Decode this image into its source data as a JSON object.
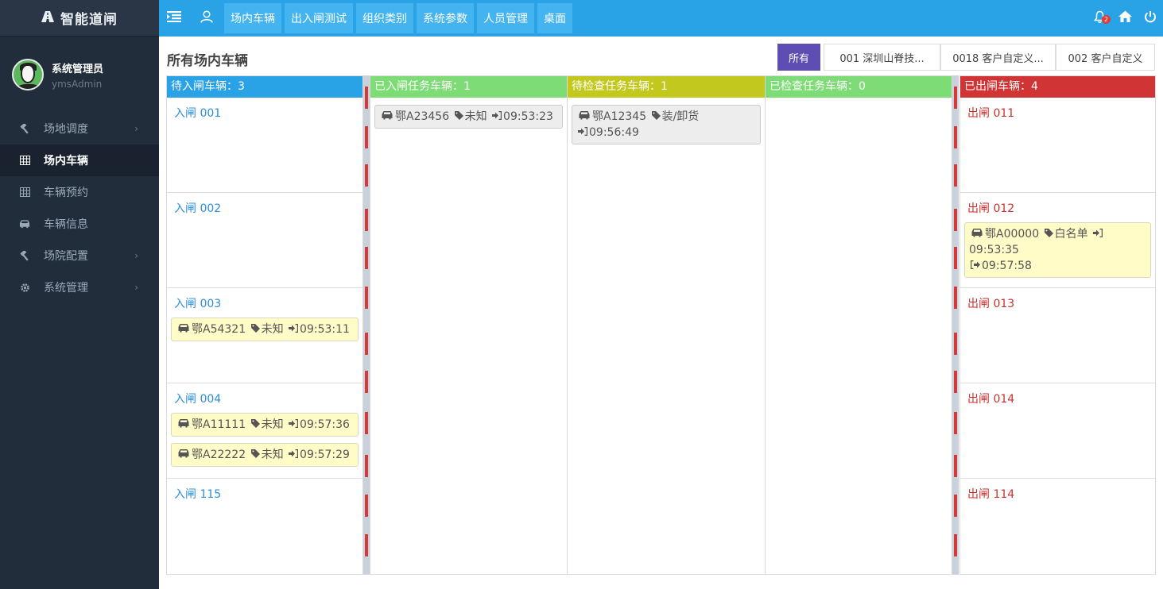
{
  "app": {
    "brand": "智能道闸"
  },
  "user": {
    "name": "系统管理员",
    "account": "ymsAdmin"
  },
  "sidebar": {
    "items": [
      {
        "label": "场地调度",
        "icon": "hammer-icon",
        "has_children": true
      },
      {
        "label": "场内车辆",
        "icon": "table-icon",
        "active": true
      },
      {
        "label": "车辆预约",
        "icon": "table-icon"
      },
      {
        "label": "车辆信息",
        "icon": "car-icon"
      },
      {
        "label": "场院配置",
        "icon": "hammer-icon",
        "has_children": true
      },
      {
        "label": "系统管理",
        "icon": "gear-icon",
        "has_children": true
      }
    ]
  },
  "topbar": {
    "tabs": [
      "场内车辆",
      "出入闸测试",
      "组织类别",
      "系统参数",
      "人员管理",
      "桌面"
    ],
    "notification_count": "2"
  },
  "page": {
    "title": "所有场内车辆"
  },
  "filters": [
    "所有",
    "001 深圳山脊技...",
    "0018 客户自定义...",
    "002 客户自定义"
  ],
  "columns": {
    "pending_in": {
      "header": "待入闸车辆：3",
      "color": "#29a2e6",
      "lanes": [
        {
          "title": "入闸 001",
          "cards": []
        },
        {
          "title": "入闸 002",
          "cards": []
        },
        {
          "title": "入闸 003",
          "cards": [
            {
              "plate": "鄂A54321",
              "tag": "未知",
              "in_time": "09:53:11"
            }
          ]
        },
        {
          "title": "入闸 004",
          "cards": [
            {
              "plate": "鄂A11111",
              "tag": "未知",
              "in_time": "09:57:36"
            },
            {
              "plate": "鄂A22222",
              "tag": "未知",
              "in_time": "09:57:29"
            }
          ]
        },
        {
          "title": "入闸 115",
          "cards": []
        }
      ]
    },
    "entered": {
      "header": "已入闸任务车辆：1",
      "color": "#7ddc75",
      "cards": [
        {
          "plate": "鄂A23456",
          "tag": "未知",
          "in_time": "09:53:23"
        }
      ]
    },
    "pending_check": {
      "header": "待检查任务车辆：1",
      "color": "#c3c81e",
      "cards": [
        {
          "plate": "鄂A12345",
          "tag": "装/卸货",
          "in_time": "09:56:49"
        }
      ]
    },
    "checked": {
      "header": "已检查任务车辆：0",
      "color": "#7ddc75",
      "cards": []
    },
    "exited": {
      "header": "已出闸车辆：4",
      "color": "#d13434",
      "lanes": [
        {
          "title": "出闸 011",
          "cards": []
        },
        {
          "title": "出闸 012",
          "cards": [
            {
              "plate": "鄂A00000",
              "tag": "白名单",
              "in_time": "09:53:35",
              "out_time": "09:57:58"
            }
          ]
        },
        {
          "title": "出闸 013",
          "cards": []
        },
        {
          "title": "出闸 014",
          "cards": []
        },
        {
          "title": "出闸 114",
          "cards": []
        }
      ]
    }
  }
}
